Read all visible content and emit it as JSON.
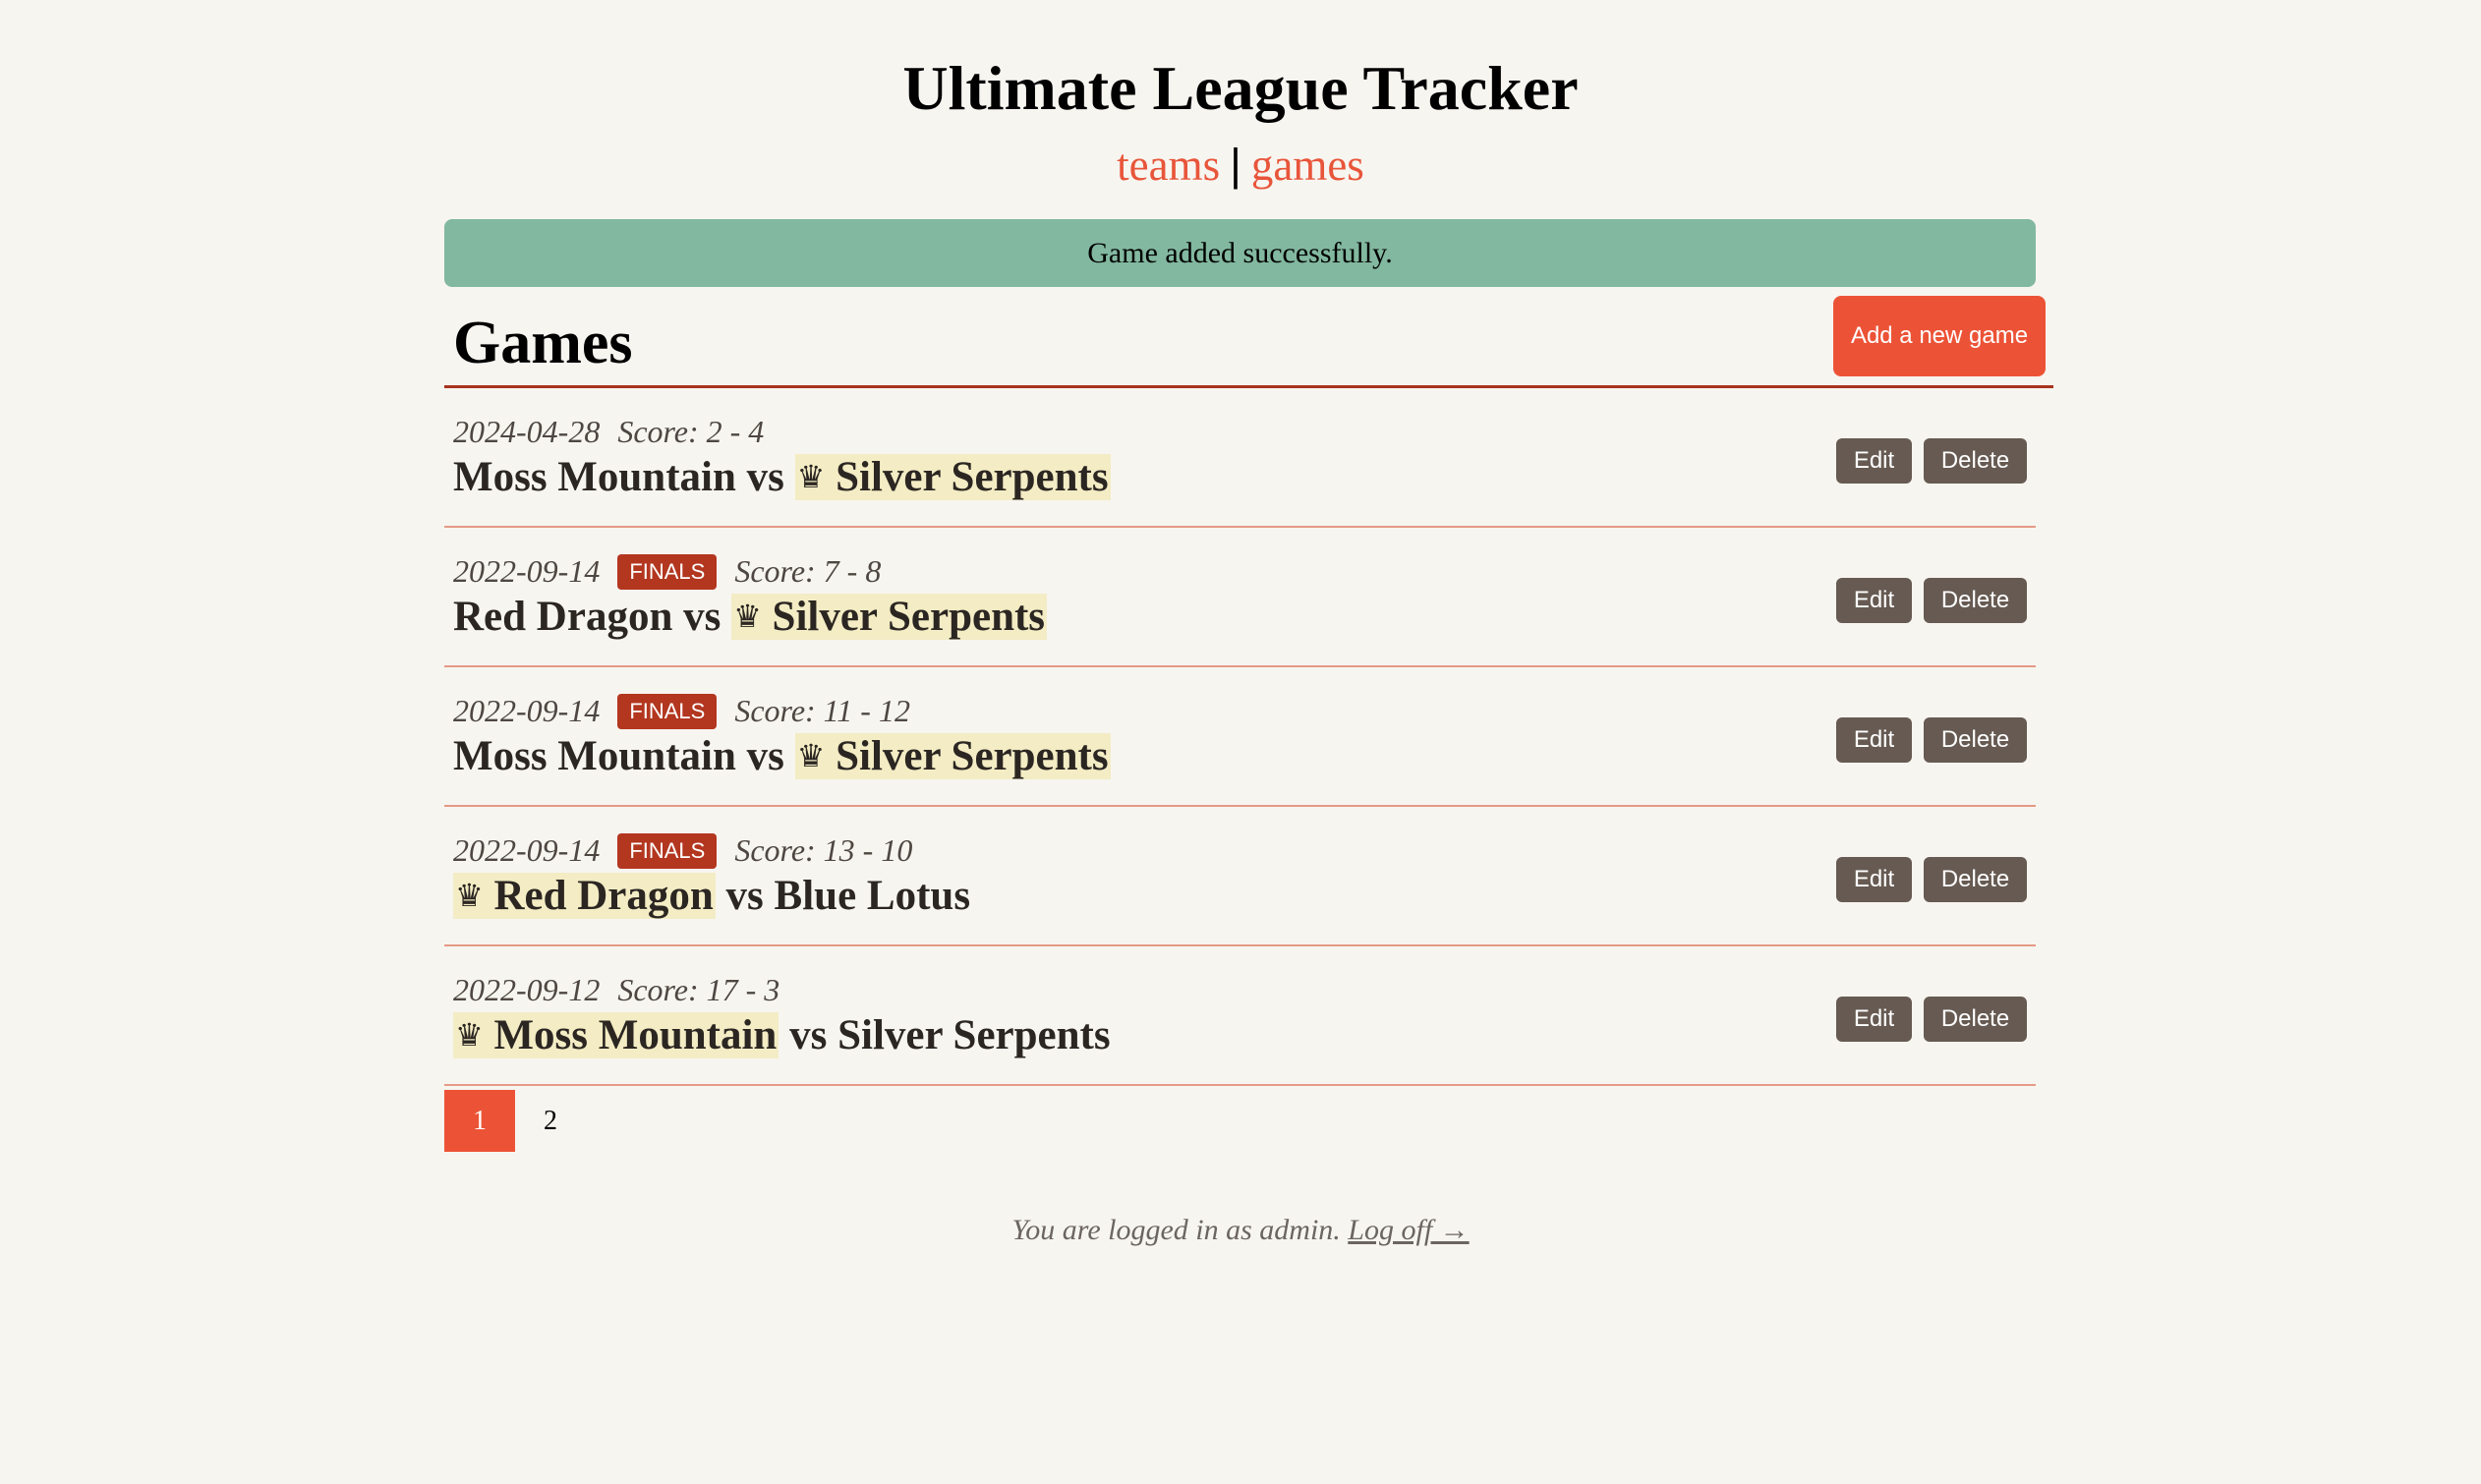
{
  "site": {
    "title": "Ultimate League Tracker"
  },
  "nav": {
    "teams": "teams",
    "separator": "|",
    "games": "games"
  },
  "alert": {
    "message": "Game added successfully."
  },
  "games_section": {
    "title": "Games",
    "add_button": "Add a new game"
  },
  "games": [
    {
      "date": "2024-04-28",
      "badge": "",
      "score": "Score: 2 - 4",
      "team1": "Moss Mountain",
      "vs": "vs",
      "team2": "Silver Serpents",
      "winner": 2
    },
    {
      "date": "2022-09-14",
      "badge": "FINALS",
      "score": "Score: 7 - 8",
      "team1": "Red Dragon",
      "vs": "vs",
      "team2": "Silver Serpents",
      "winner": 2
    },
    {
      "date": "2022-09-14",
      "badge": "FINALS",
      "score": "Score: 11 - 12",
      "team1": "Moss Mountain",
      "vs": "vs",
      "team2": "Silver Serpents",
      "winner": 2
    },
    {
      "date": "2022-09-14",
      "badge": "FINALS",
      "score": "Score: 13 - 10",
      "team1": "Red Dragon",
      "vs": "vs",
      "team2": "Blue Lotus",
      "winner": 1
    },
    {
      "date": "2022-09-12",
      "badge": "",
      "score": "Score: 17 - 3",
      "team1": "Moss Mountain",
      "vs": "vs",
      "team2": "Silver Serpents",
      "winner": 1
    }
  ],
  "row_actions": {
    "edit": "Edit",
    "delete": "Delete"
  },
  "crown_glyph": "♛",
  "pagination": {
    "pages": [
      "1",
      "2"
    ],
    "current": "1"
  },
  "footer": {
    "text": "You are logged in as admin.",
    "logoff": "Log off →"
  },
  "colors": {
    "accent": "#ec5336",
    "link": "#e8553a",
    "alert_bg": "#82b8a0",
    "finals_badge": "#b3361f",
    "winner_highlight": "#f3ecc4",
    "action_button": "#665a52"
  }
}
